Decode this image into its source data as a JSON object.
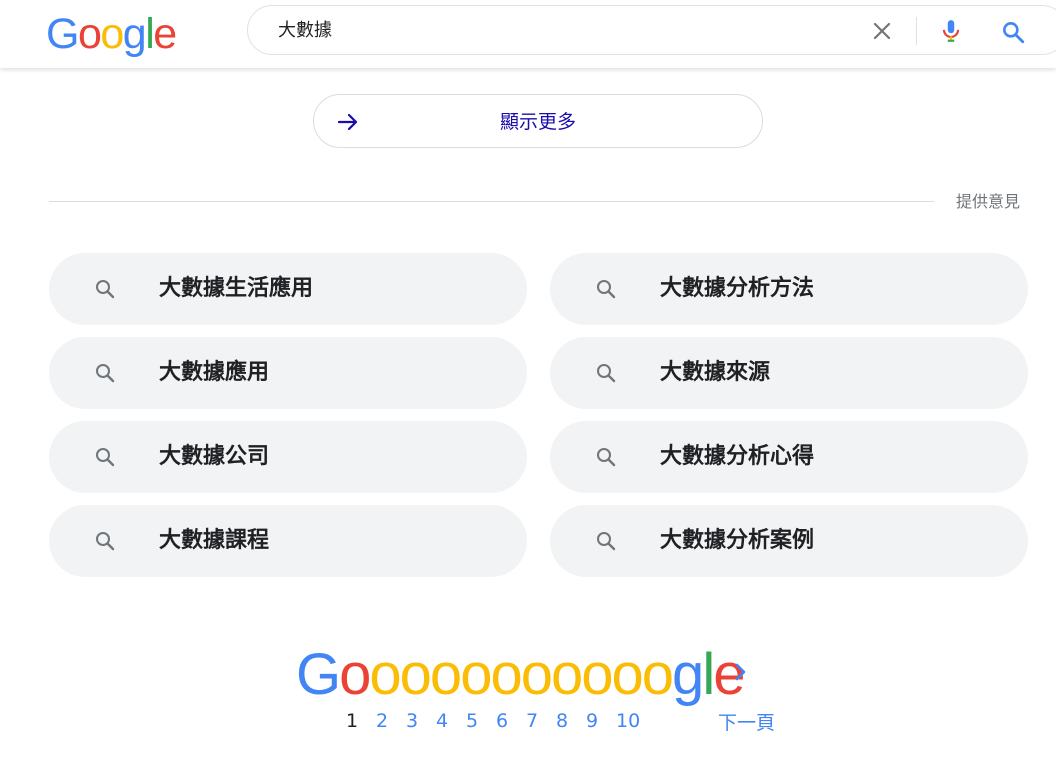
{
  "logo": {
    "letters": [
      "G",
      "o",
      "o",
      "g",
      "l",
      "e"
    ],
    "colors": [
      "#4285f4",
      "#ea4335",
      "#fbbc05",
      "#4285f4",
      "#34a853",
      "#ea4335"
    ]
  },
  "search": {
    "query": "大數據"
  },
  "icons": {
    "clear": "close-icon",
    "mic": "mic-icon",
    "search": "search-icon",
    "arrow": "arrow-right-icon",
    "next": "chevron-right-icon"
  },
  "show_more": {
    "label": "顯示更多"
  },
  "feedback": {
    "label": "提供意見"
  },
  "related": [
    {
      "label": "大數據生活應用"
    },
    {
      "label": "大數據分析方法"
    },
    {
      "label": "大數據應用"
    },
    {
      "label": "大數據來源"
    },
    {
      "label": "大數據公司"
    },
    {
      "label": "大數據分析心得"
    },
    {
      "label": "大數據課程"
    },
    {
      "label": "大數據分析案例"
    }
  ],
  "pagination": {
    "pages": [
      "1",
      "2",
      "3",
      "4",
      "5",
      "6",
      "7",
      "8",
      "9",
      "10"
    ],
    "current": "1",
    "next_label": "下一頁",
    "logo_text": "Gooooooooooogle"
  },
  "colors": {
    "blue": "#4285f4",
    "red": "#ea4335",
    "yellow": "#fbbc05",
    "green": "#34a853",
    "link": "#1a0dab"
  }
}
